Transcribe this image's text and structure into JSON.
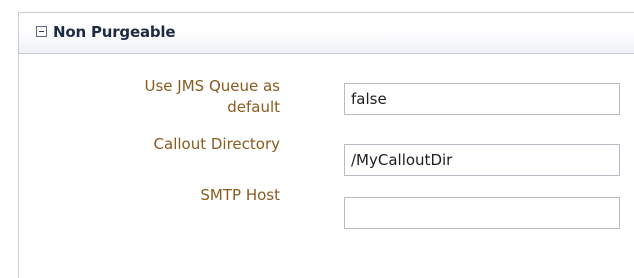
{
  "section": {
    "title": "Non Purgeable",
    "toggle_icon": "collapse-minus-icon"
  },
  "fields": [
    {
      "label_line1": "Use JMS Queue as",
      "label_line2": "default",
      "value": "false"
    },
    {
      "label": "Callout Directory",
      "value": "/MyCalloutDir"
    },
    {
      "label": "SMTP Host",
      "value": ""
    }
  ],
  "colors": {
    "label": "#8a5a1e",
    "title": "#1f2a44",
    "border": "#c9ced6"
  }
}
